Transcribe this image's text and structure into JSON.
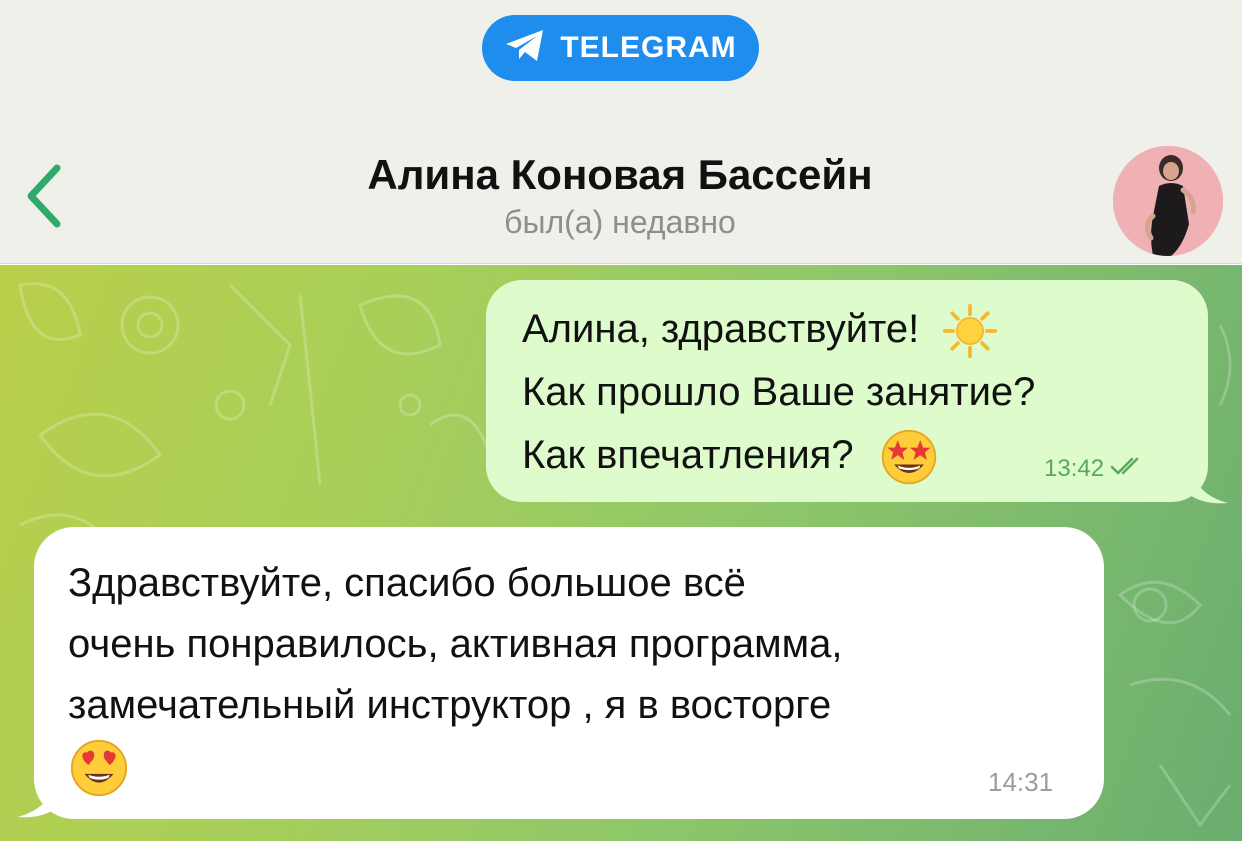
{
  "badge": {
    "label": "TELEGRAM",
    "icon": "telegram-plane-icon",
    "color": "#1f8ded"
  },
  "header": {
    "back_icon": "chevron-left-icon",
    "title": "Алина Коновая Бассейн",
    "status": "был(а) недавно",
    "avatar": "contact-avatar"
  },
  "messages": [
    {
      "direction": "outgoing",
      "lines": [
        "Алина, здравствуйте!",
        "Как прошло Ваше занятие?",
        "Как впечатления?"
      ],
      "emojis": [
        "sun-emoji",
        "star-struck-emoji"
      ],
      "time": "13:42",
      "status_icon": "double-check-icon"
    },
    {
      "direction": "incoming",
      "lines": [
        "Здравствуйте, спасибо большое всё",
        "очень понравилось, активная программа,",
        "замечательный инструктор , я в восторге"
      ],
      "emojis": [
        "heart-eyes-emoji"
      ],
      "time": "14:31"
    }
  ],
  "colors": {
    "accent": "#1f8ded",
    "back_chevron": "#2eaa6a",
    "outgoing_bubble": "#defbcc",
    "incoming_bubble": "#ffffff",
    "read_check": "#5aa85a"
  }
}
